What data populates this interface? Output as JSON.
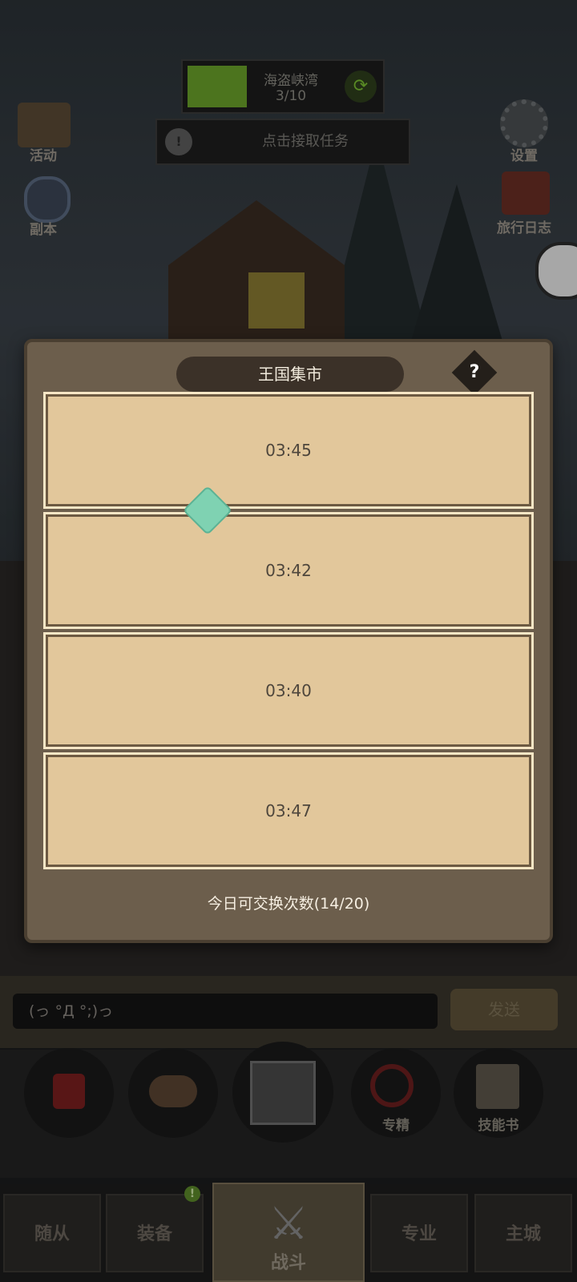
{
  "hud": {
    "zone_name": "海盗峡湾",
    "zone_progress": "3/10",
    "quest_prompt": "点击接取任务",
    "accent_color": "#6aa12a"
  },
  "side_left": [
    {
      "label": "活动",
      "icon": "scroll-icon"
    },
    {
      "label": "副本",
      "icon": "portal-icon"
    }
  ],
  "side_right": [
    {
      "label": "设置",
      "icon": "gear-icon"
    },
    {
      "label": "旅行日志",
      "icon": "journal-icon"
    }
  ],
  "market": {
    "title": "王国集市",
    "help_label": "?",
    "cards": [
      {
        "time": "03:45"
      },
      {
        "time": "03:42"
      },
      {
        "time": "03:40"
      },
      {
        "time": "03:47"
      }
    ],
    "exchange_text": "今日可交换次数(14/20)"
  },
  "chat": {
    "input_value": "(っ °Д °;)っ",
    "send_label": "发送"
  },
  "dock": [
    {
      "label": "",
      "icon": "potion-icon"
    },
    {
      "label": "",
      "icon": "bread-icon"
    },
    {
      "label": "",
      "icon": "chest-icon"
    },
    {
      "label": "专精",
      "icon": "specialize-icon"
    },
    {
      "label": "技能书",
      "icon": "skillbook-icon"
    }
  ],
  "tabs": [
    {
      "label": "随从"
    },
    {
      "label": "装备"
    },
    {
      "label": "战斗"
    },
    {
      "label": "专业"
    },
    {
      "label": "主城"
    }
  ],
  "badge_text": "!"
}
